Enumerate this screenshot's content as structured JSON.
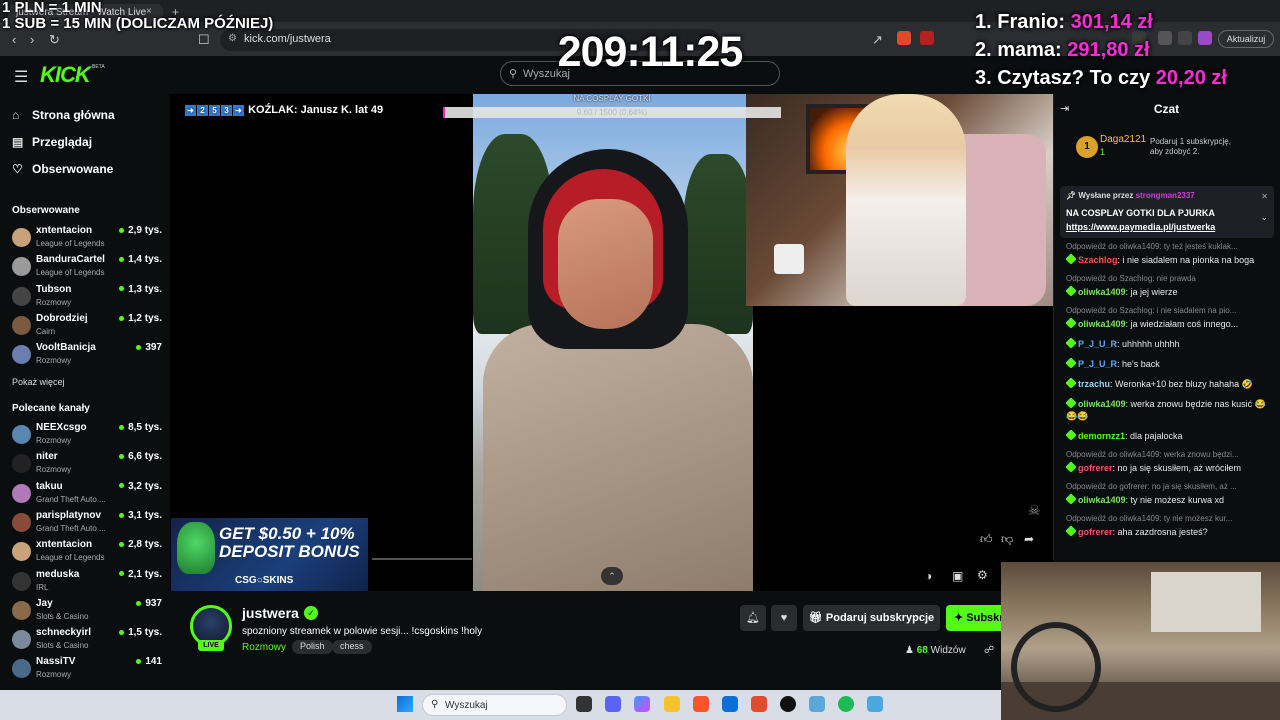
{
  "browser": {
    "tab_title": "justwera Stream - Watch Live",
    "tab_close": "×",
    "new_tab": "+",
    "url": "kick.com/justwera",
    "update_label": "Aktualizuj"
  },
  "overlay": {
    "rate_line1": "1 PLN = 1 MIN",
    "rate_line2": "1 SUB = 15 MIN (DOLICZAM PÓŹNIEJ)",
    "timer": "209:11:25",
    "leaderboard": [
      {
        "rank": "1. Franio:",
        "amount": "301,14 zł"
      },
      {
        "rank": "2. mama:",
        "amount": "291,80 zł"
      },
      {
        "rank": "3. Czytasz? To czy",
        "amount": "20,20 zł"
      }
    ],
    "kozlak_text": "KOŹLAK: Janusz K. lat 49",
    "goal_title": "NA COSPLAY GOTKI",
    "goal_progress": "9,60 / 1500 (0,64%)",
    "goal_fraction": 0.0064,
    "promo_line1": "GET $0.50 + 10%",
    "promo_line2": "DEPOSIT BONUS",
    "promo_brand": "CSG○SKINS"
  },
  "header": {
    "logo": "KICK",
    "beta": "BETA",
    "search_placeholder": "Wyszukaj"
  },
  "sidebar": {
    "nav": [
      {
        "icon": "home-icon",
        "label": "Strona główna"
      },
      {
        "icon": "browse-icon",
        "label": "Przeglądaj"
      },
      {
        "icon": "heart-icon",
        "label": "Obserwowane"
      }
    ],
    "followed_title": "Obserwowane",
    "followed": [
      {
        "name": "xntentacion",
        "category": "League of Legends",
        "viewers": "2,9 tys.",
        "color": "#c7a27a"
      },
      {
        "name": "BanduraCartel",
        "category": "League of Legends",
        "viewers": "1,4 tys.",
        "color": "#9a9a9a"
      },
      {
        "name": "Tubson",
        "category": "Rozmowy",
        "viewers": "1,3 tys.",
        "color": "#444444"
      },
      {
        "name": "Dobrodziej",
        "category": "Cairn",
        "viewers": "1,2 tys.",
        "color": "#7a5a40"
      },
      {
        "name": "VooltBanicja",
        "category": "Rozmowy",
        "viewers": "397",
        "color": "#6a7fb0"
      }
    ],
    "show_more": "Pokaż więcej",
    "recommended_title": "Polecane kanały",
    "recommended": [
      {
        "name": "NEEXcsgo",
        "category": "Rozmowy",
        "viewers": "8,5 tys.",
        "color": "#5a86b0"
      },
      {
        "name": "niter",
        "category": "Rozmowy",
        "viewers": "6,6 tys.",
        "color": "#222222"
      },
      {
        "name": "takuu",
        "category": "Grand Theft Auto ...",
        "viewers": "3,2 tys.",
        "color": "#b07ab8"
      },
      {
        "name": "parisplatynov",
        "category": "Grand Theft Auto ...",
        "viewers": "3,1 tys.",
        "color": "#8a4a3a"
      },
      {
        "name": "xntentacion",
        "category": "League of Legends",
        "viewers": "2,8 tys.",
        "color": "#c7a27a"
      },
      {
        "name": "meduska",
        "category": "IRL",
        "viewers": "2,1 tys.",
        "color": "#333333"
      },
      {
        "name": "Jay",
        "category": "Slots & Casino",
        "viewers": "937",
        "color": "#8a6a4a"
      },
      {
        "name": "schneckyirl",
        "category": "Slots & Casino",
        "viewers": "1,5 tys.",
        "color": "#7a8a9a"
      },
      {
        "name": "NassiTV",
        "category": "Rozmowy",
        "viewers": "141",
        "color": "#4a6a8a"
      }
    ]
  },
  "channel": {
    "name": "justwera",
    "live": "LIVE",
    "title": "spozniony streamek w polowie sesji... !csgoskins !holy",
    "category": "Rozmowy",
    "tags": [
      "Polish",
      "chess"
    ],
    "gift_label": "Podaruj subskrypcje",
    "subscribe_label": "Subskrybuj",
    "viewers_count": "68",
    "viewers_label": "Widzów"
  },
  "chat": {
    "title": "Czat",
    "gift_rank": "1",
    "gift_user": "Daga2121",
    "gift_user_count": "1",
    "gift_hint_l1": "Podaruj 1 subskrypcję,",
    "gift_hint_l2": "aby zdobyć 2.",
    "pinned_by_label": "Wysłane przez",
    "pinned_by_user": "strongman2337",
    "pinned_l1": "NA COSPLAY GOTKI DLA PJURKA",
    "pinned_l2": "https://www.paymedia.pl/justwerka",
    "messages": [
      {
        "reply": "Odpowiedź do oliwka1409: ty też jesteś kuklak...",
        "user": "Szachlog",
        "color": "#ff4d4d",
        "text": ": i nie siadalem na pionka na boga"
      },
      {
        "reply": "Odpowiedź do Szachlog: nie prawda",
        "user": "oliwka1409",
        "color": "#7be36a",
        "text": ": ja jej wierze"
      },
      {
        "reply": "Odpowiedź do Szachlog: i nie siadalem na pio...",
        "user": "oliwka1409",
        "color": "#7be36a",
        "text": ": ja wiedziałam coś innego..."
      },
      {
        "reply": "",
        "user": "P_J_U_R",
        "color": "#5aa8ff",
        "text": ": uhhhhh uhhhh"
      },
      {
        "reply": "",
        "user": "P_J_U_R",
        "color": "#5aa8ff",
        "text": ": he's back"
      },
      {
        "reply": "",
        "user": "trzachu",
        "color": "#8ad6ff",
        "text": ": Weronka+10 bez bluzy hahaha 🤣"
      },
      {
        "reply": "",
        "user": "oliwka1409",
        "color": "#7be36a",
        "text": ": werka znowu będzie nas kusić 😂😂😂"
      },
      {
        "reply": "",
        "user": "demornzz1",
        "color": "#53fc18",
        "text": ": dla pajalocka"
      },
      {
        "reply": "Odpowiedź do oliwka1409: werka znowu będzi...",
        "user": "gofrerer",
        "color": "#ff4d6a",
        "text": ": no ja się skusiłem, aż wróciłem"
      },
      {
        "reply": "Odpowiedź do gofrerer: no ja się skusiłem, aż ...",
        "user": "oliwka1409",
        "color": "#7be36a",
        "text": ": ty nie możesz kurwa xd"
      },
      {
        "reply": "Odpowiedź do oliwka1409: ty nie możesz kur...",
        "user": "gofrerer",
        "color": "#ff4d6a",
        "text": ": aha zazdrosna jesteś?"
      }
    ]
  },
  "taskbar": {
    "search_placeholder": "Wyszukaj"
  }
}
